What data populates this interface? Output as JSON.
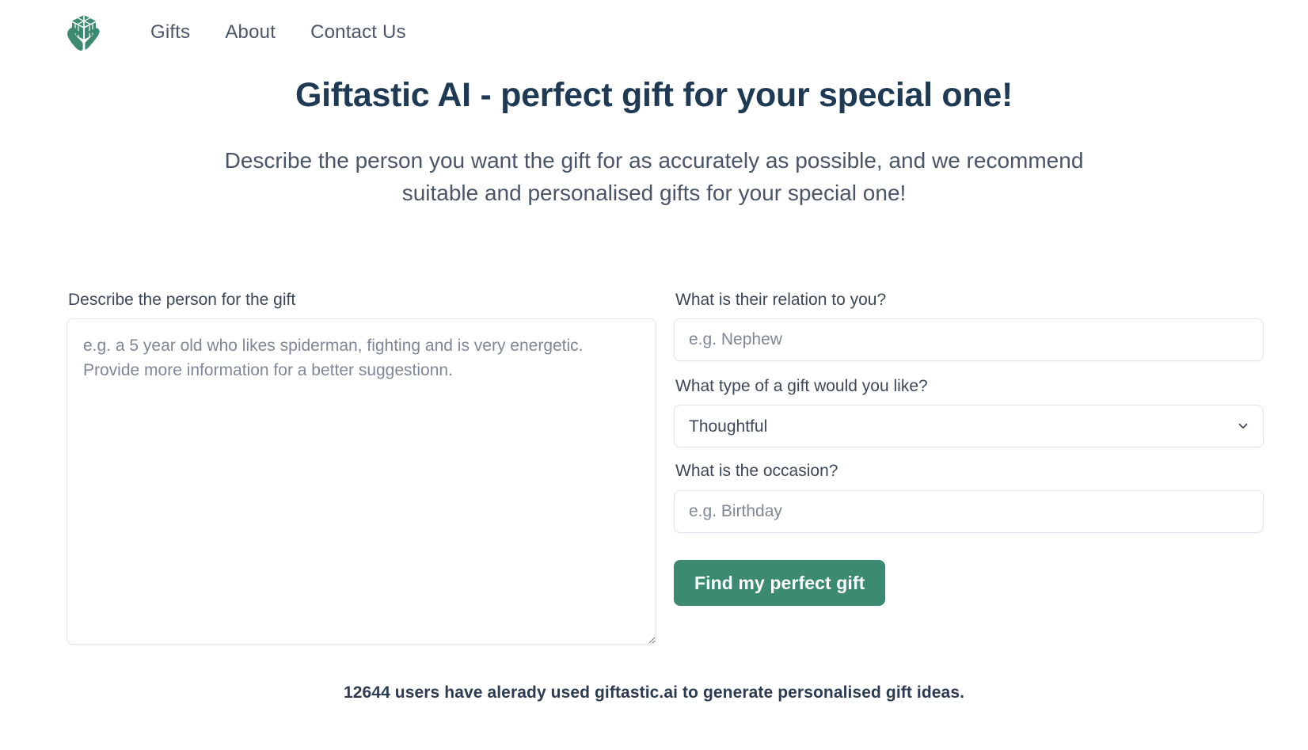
{
  "brand": {
    "logo_icon": "hands-holding-gift-box-icon",
    "logo_color": "#3d8a73"
  },
  "nav": {
    "items": [
      {
        "label": "Gifts",
        "name": "nav-link-gifts"
      },
      {
        "label": "About",
        "name": "nav-link-about"
      },
      {
        "label": "Contact Us",
        "name": "nav-link-contact-us"
      }
    ]
  },
  "hero": {
    "title": "Giftastic AI - perfect gift for your special one!",
    "subtitle": "Describe the person you want the gift for as accurately as possible, and we recommend suitable and personalised gifts for your special one!"
  },
  "form": {
    "describe": {
      "label": "Describe the person for the gift",
      "placeholder": "e.g. a 5 year old who likes spiderman, fighting and is very energetic. Provide more information for a better suggestionn.",
      "value": ""
    },
    "relation": {
      "label": "What is their relation to you?",
      "placeholder": "e.g. Nephew",
      "value": ""
    },
    "gift_type": {
      "label": "What type of a gift would you like?",
      "selected": "Thoughtful",
      "options": [
        "Thoughtful"
      ],
      "chevron_icon": "chevron-down-icon"
    },
    "occasion": {
      "label": "What is the occasion?",
      "placeholder": "e.g. Birthday",
      "value": ""
    },
    "submit": {
      "label": "Find my perfect gift",
      "color": "#3d8a73"
    }
  },
  "footer": {
    "note": "12644 users have alerady used giftastic.ai to generate personalised gift ideas."
  }
}
